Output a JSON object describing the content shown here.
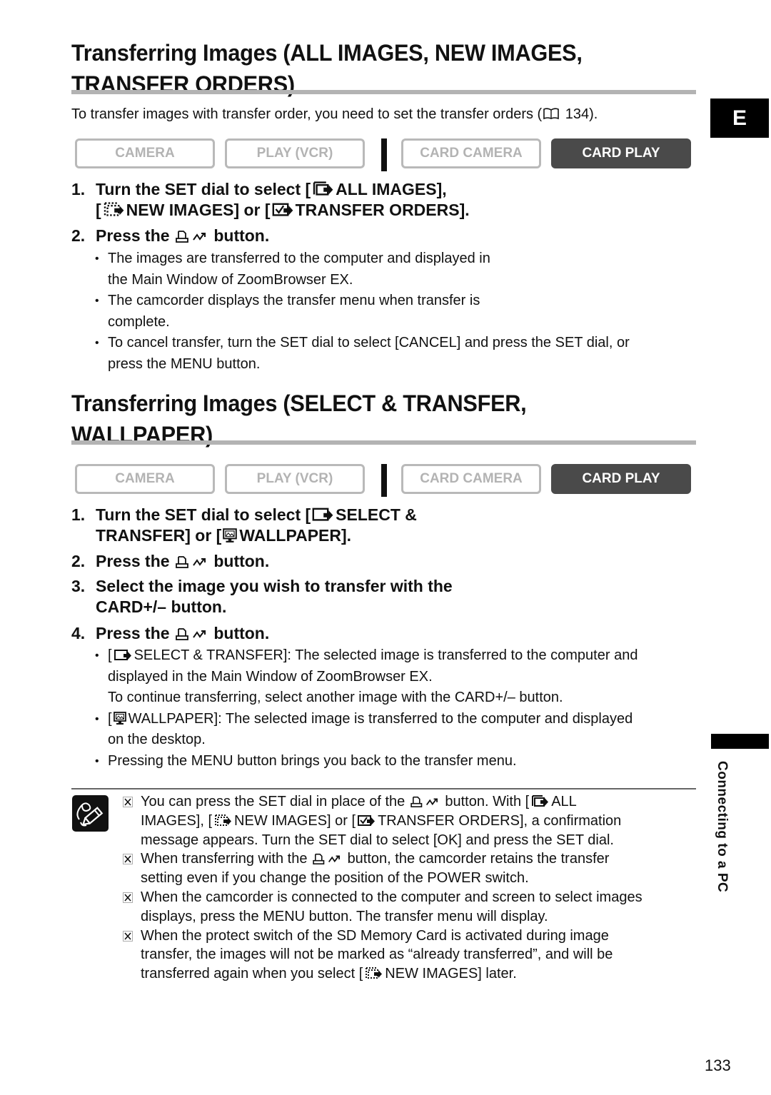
{
  "language_tab": "E",
  "side_label": "Connecting to a PC",
  "page_number": "133",
  "section1": {
    "title_line1": "Transferring Images (ALL IMAGES, NEW IMAGES,",
    "title_line2": "TRANSFER ORDERS)",
    "intro": "To transfer images with transfer order, you need to set the transfer orders (",
    "intro_ref": "134).",
    "modes": [
      {
        "label": "CAMERA",
        "active": false
      },
      {
        "label": "PLAY (VCR)",
        "active": false
      },
      {
        "label": "CARD CAMERA",
        "active": false
      },
      {
        "label": "CARD PLAY",
        "active": true
      }
    ],
    "steps": [
      {
        "num": "1.",
        "a": "Turn the SET dial to select [",
        "b": "ALL IMAGES],",
        "c": "[",
        "d": "NEW IMAGES] or [",
        "e": "TRANSFER ORDERS]."
      },
      {
        "num": "2.",
        "a": "Press the",
        "b": "button."
      }
    ],
    "bullets": [
      {
        "line1": "The images are transferred to the computer and displayed in",
        "line2": "the Main Window of ZoomBrowser EX."
      },
      {
        "line1": "The camcorder displays the transfer menu when transfer is",
        "line2": "complete."
      },
      {
        "line1": "To cancel transfer, turn the SET dial to select [CANCEL] and press the SET dial, or",
        "line2": "press the MENU button."
      }
    ]
  },
  "section2": {
    "title_line1": "Transferring Images (SELECT & TRANSFER,",
    "title_line2": "WALLPAPER)",
    "modes": [
      {
        "label": "CAMERA",
        "active": false
      },
      {
        "label": "PLAY (VCR)",
        "active": false
      },
      {
        "label": "CARD CAMERA",
        "active": false
      },
      {
        "label": "CARD PLAY",
        "active": true
      }
    ],
    "steps": [
      {
        "num": "1.",
        "a": "Turn the SET dial to select [",
        "b": "SELECT &",
        "c": "TRANSFER] or [",
        "d": "WALLPAPER]."
      },
      {
        "num": "2.",
        "a": "Press the",
        "b": "button."
      },
      {
        "num": "3.",
        "a": "Select the image you wish to transfer with the",
        "b": "CARD+/– button."
      },
      {
        "num": "4.",
        "a": "Press the",
        "b": "button."
      }
    ],
    "bullets": [
      {
        "pre": "[",
        "line1": "SELECT & TRANSFER]: The selected image is transferred to the computer and",
        "line2": "displayed in the Main Window of ZoomBrowser EX.",
        "line3": "To continue transferring, select another image with the CARD+/– button."
      },
      {
        "pre": "[",
        "line1": "WALLPAPER]: The selected image is transferred to the computer and displayed",
        "line2": "on the desktop."
      },
      {
        "line1": "Pressing the MENU button brings you back to the transfer menu."
      }
    ]
  },
  "notes": [
    {
      "a": "You can press the SET dial in place of the",
      "b": "button. With [",
      "c": "ALL",
      "d": "IMAGES], [",
      "e": "NEW IMAGES] or [",
      "f": "TRANSFER ORDERS], a confirmation",
      "g": "message appears. Turn the SET dial to select [OK] and press the SET dial."
    },
    {
      "a": "When transferring with the",
      "b": "button, the camcorder retains the transfer",
      "c": "setting even if you change the position of the POWER switch."
    },
    {
      "a": "When the camcorder is connected to the computer and screen to select images",
      "b": "displays, press the MENU button. The transfer menu will display."
    },
    {
      "a": "When the protect switch of the SD Memory Card is activated during image",
      "b": "transfer, the images will not be marked as “already transferred”, and will be",
      "c": "transferred again when you select [",
      "d": "NEW IMAGES] later."
    }
  ]
}
